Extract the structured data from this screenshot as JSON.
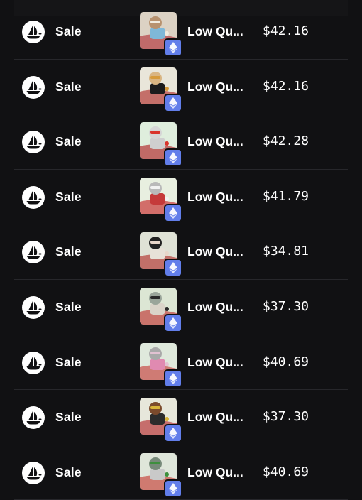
{
  "activity": {
    "rows": [
      {
        "event": "Sale",
        "name": "Low Qu...",
        "price": "$42.16",
        "art": {
          "bg": "#dcd2c4",
          "body": "#7fb8d8",
          "head": "#b8926f",
          "ground": "#c06a6a",
          "accent": "#f2ecdf"
        }
      },
      {
        "event": "Sale",
        "name": "Low Qu...",
        "price": "$42.16",
        "art": {
          "bg": "#e9e6da",
          "body": "#1c1c1c",
          "head": "#d9b582",
          "ground": "#c46f69",
          "accent": "#d69a3a"
        }
      },
      {
        "event": "Sale",
        "name": "Low Qu...",
        "price": "$42.28",
        "art": {
          "bg": "#dfeedd",
          "body": "#cfcfcf",
          "head": "#d6d6d6",
          "ground": "#c06a66",
          "accent": "#d9342c"
        }
      },
      {
        "event": "Sale",
        "name": "Low Qu...",
        "price": "$41.79",
        "art": {
          "bg": "#e8efe0",
          "body": "#c53a3a",
          "head": "#b9b9b9",
          "ground": "#d26e6a",
          "accent": "#f2f2f2"
        }
      },
      {
        "event": "Sale",
        "name": "Low Qu...",
        "price": "$34.81",
        "art": {
          "bg": "#dfe2d6",
          "body": "#e7e1d7",
          "head": "#222222",
          "ground": "#c16f68",
          "accent": "#e8d6c9"
        }
      },
      {
        "event": "Sale",
        "name": "Low Qu...",
        "price": "$37.30",
        "art": {
          "bg": "#dce6d4",
          "body": "#dad4c9",
          "head": "#9aa59a",
          "ground": "#c9736b",
          "accent": "#2a2a2a"
        }
      },
      {
        "event": "Sale",
        "name": "Low Qu...",
        "price": "$40.69",
        "art": {
          "bg": "#dfe9dc",
          "body": "#e08ab1",
          "head": "#a9a9a9",
          "ground": "#cf7b74",
          "accent": "#e2c2d2"
        }
      },
      {
        "event": "Sale",
        "name": "Low Qu...",
        "price": "$37.30",
        "art": {
          "bg": "#e7e7db",
          "body": "#2c2c2c",
          "head": "#7b4a2c",
          "ground": "#c66e6c",
          "accent": "#d9b43a"
        }
      },
      {
        "event": "Sale",
        "name": "Low Qu...",
        "price": "$40.69",
        "art": {
          "bg": "#dfe6da",
          "body": "#c9c9c9",
          "head": "#778a7a",
          "ground": "#cf7a70",
          "accent": "#3d8f3d"
        }
      }
    ]
  },
  "icons": {
    "marketplace": "opensea-boat-icon",
    "chain": "ethereum-icon"
  },
  "colors": {
    "background": "#111113",
    "divider": "#27272b",
    "eth_badge": "#627eea",
    "text": "#ffffff"
  }
}
